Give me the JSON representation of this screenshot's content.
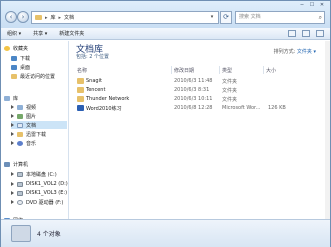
{
  "address": {
    "crumbs": [
      "库",
      "文档"
    ]
  },
  "search": {
    "placeholder": "搜索 文档"
  },
  "toolbar": {
    "organize": "组织 ▾",
    "share": "共享 ▾",
    "new_folder": "新建文件夹"
  },
  "window_buttons": [
    "─",
    "☐",
    "✕"
  ],
  "nav": {
    "favorites": {
      "label": "收藏夹",
      "items": [
        "下载",
        "桌面",
        "最近访问的位置"
      ]
    },
    "libraries": {
      "label": "库",
      "items": [
        "视频",
        "图片",
        "文档",
        "迅雷下载",
        "音乐"
      ],
      "selected": "文档"
    },
    "computer": {
      "label": "计算机",
      "items": [
        "本地磁盘 (C:)",
        "DISK1_VOL2 (D:)",
        "DISK1_VOL3 (E:)",
        "DVD 驱动器 (F:)"
      ]
    },
    "network": {
      "label": "网络"
    }
  },
  "content": {
    "title": "文档库",
    "subtitle": "包括: 2 个位置",
    "arrange_label": "排列方式:",
    "arrange_value": "文件夹 ▾",
    "columns": {
      "name": "名称",
      "date": "修改日期",
      "type": "类型",
      "size": "大小"
    },
    "files": [
      {
        "name": "Snagit",
        "date": "2010/6/3 11:48",
        "type": "文件夹",
        "size": "",
        "icon": "folder-icon"
      },
      {
        "name": "Tencent",
        "date": "2010/6/3 8:31",
        "type": "文件夹",
        "size": "",
        "icon": "folder-icon"
      },
      {
        "name": "Thunder Network",
        "date": "2010/6/3 10:11",
        "type": "文件夹",
        "size": "",
        "icon": "folder-icon"
      },
      {
        "name": "Word2010练习",
        "date": "2010/6/8 12:28",
        "type": "Microsoft Wor...",
        "size": "126 KB",
        "icon": "word-doc-icon"
      }
    ]
  },
  "details": {
    "text": "4 个对象"
  }
}
